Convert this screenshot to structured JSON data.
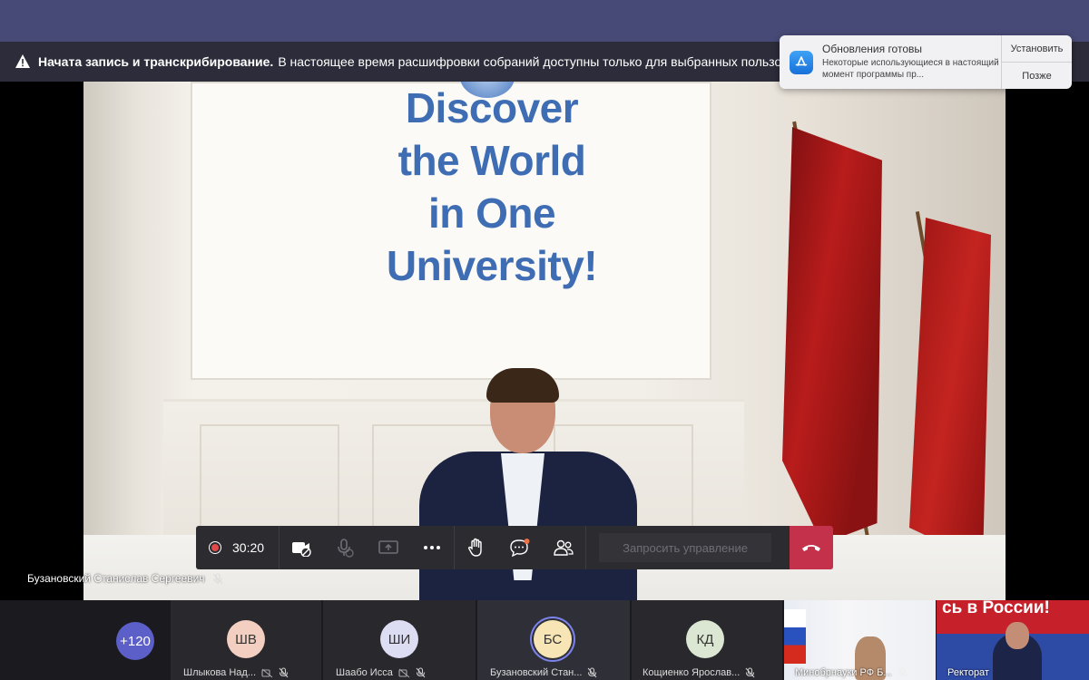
{
  "banner": {
    "bold": "Начата запись и транскрибирование.",
    "text": "В настоящее время расшифровки собраний доступны только для выбранных пользоват"
  },
  "notification": {
    "title": "Обновления готовы",
    "body": "Некоторые использующиеся в настоящий момент программы пр...",
    "install": "Установить",
    "later": "Позже"
  },
  "video": {
    "slogan": [
      "Discover",
      "the World",
      "in One",
      "University!"
    ],
    "speaker_name": "Бузановский Станислав Сергеевич"
  },
  "toolbar": {
    "timer": "30:20",
    "request_control": "Запросить управление"
  },
  "participants": {
    "more_count": "+120",
    "tiles": [
      {
        "initials": "ШВ",
        "name": "Шлыкова Над...",
        "color": "#f3cfc2"
      },
      {
        "initials": "ШИ",
        "name": "Шаабо Исса",
        "color": "#dcdcf3"
      },
      {
        "initials": "БС",
        "name": "Бузановский Стан...",
        "color": "#f7e5b5"
      },
      {
        "initials": "КД",
        "name": "Кощиенко Ярослав...",
        "color": "#dbe7d2"
      }
    ],
    "video_tiles": [
      {
        "name": "Минобрнауки РФ Б..."
      },
      {
        "name": "Ректорат",
        "overlay": "сь в России!"
      }
    ]
  }
}
